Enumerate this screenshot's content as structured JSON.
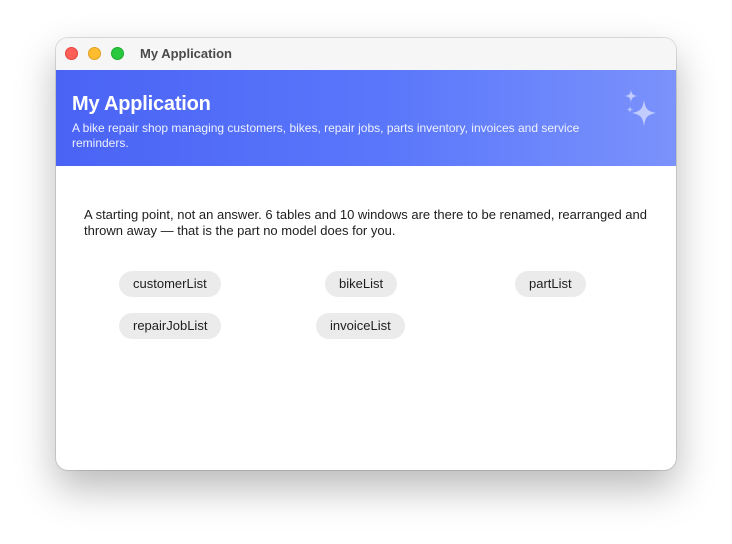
{
  "window": {
    "title": "My Application"
  },
  "hero": {
    "title": "My Application",
    "subtitle": "A bike repair shop managing customers, bikes, repair jobs, parts inventory, invoices and service reminders.",
    "icon": "sparkles-icon"
  },
  "content": {
    "intro": "A starting point, not an answer. 6 tables and 10 windows are there to be renamed, rearranged and thrown away — that is the part no model does for you.",
    "buttons": [
      {
        "label": "customerList"
      },
      {
        "label": "bikeList"
      },
      {
        "label": "partList"
      },
      {
        "label": "repairJobList"
      },
      {
        "label": "invoiceList"
      }
    ]
  },
  "colors": {
    "accent_start": "#4a63f5",
    "accent_end": "#7b92fb",
    "chip_bg": "#ebebeb",
    "close": "#fe5f57",
    "minimize": "#febc2e",
    "maximize": "#28c840"
  }
}
